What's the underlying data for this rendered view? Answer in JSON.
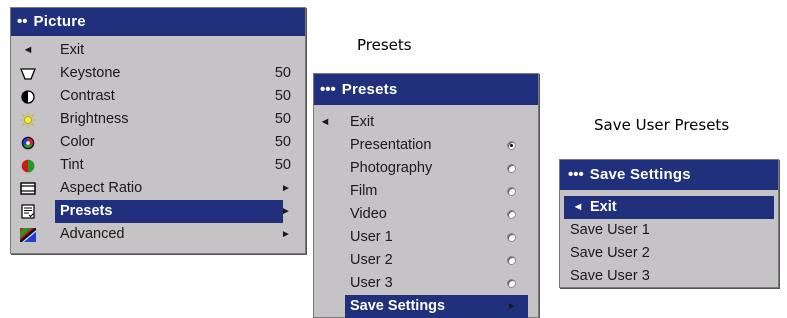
{
  "picture_menu": {
    "title": "Picture",
    "title_dots": "••",
    "items": [
      {
        "icon": "left-arrow-icon",
        "glyph": "◄",
        "label": "Exit",
        "value": ""
      },
      {
        "icon": "keystone-icon",
        "glyph": "",
        "label": "Keystone",
        "value": "50"
      },
      {
        "icon": "contrast-icon",
        "glyph": "",
        "label": "Contrast",
        "value": "50"
      },
      {
        "icon": "brightness-icon",
        "glyph": "",
        "label": "Brightness",
        "value": "50"
      },
      {
        "icon": "color-icon",
        "glyph": "",
        "label": "Color",
        "value": "50"
      },
      {
        "icon": "tint-icon",
        "glyph": "",
        "label": "Tint",
        "value": "50"
      },
      {
        "icon": "aspect-ratio-icon",
        "glyph": "",
        "label": "Aspect Ratio",
        "arrow": "►"
      },
      {
        "icon": "presets-icon",
        "glyph": "",
        "label": "Presets",
        "arrow": "►"
      },
      {
        "icon": "advanced-icon",
        "glyph": "",
        "label": "Advanced",
        "arrow": "►"
      }
    ]
  },
  "presets_menu": {
    "caption": "Presets",
    "title": "Presets",
    "title_dots": "•••",
    "exit_glyph": "◄",
    "items": [
      {
        "label": "Exit"
      },
      {
        "label": "Presentation",
        "radio": "selected"
      },
      {
        "label": "Photography",
        "radio": "unselected"
      },
      {
        "label": "Film",
        "radio": "unselected"
      },
      {
        "label": "Video",
        "radio": "unselected"
      },
      {
        "label": "User 1",
        "radio": "unselected"
      },
      {
        "label": "User 2",
        "radio": "unselected"
      },
      {
        "label": "User 3",
        "radio": "unselected"
      },
      {
        "label": "Save Settings",
        "arrow": "►"
      }
    ]
  },
  "save_menu": {
    "caption": "Save User Presets",
    "title": "Save Settings",
    "title_dots": "•••",
    "exit_glyph": "◄",
    "items": [
      {
        "label": "Exit"
      },
      {
        "label": "Save User 1"
      },
      {
        "label": "Save User 2"
      },
      {
        "label": "Save User 3"
      }
    ]
  },
  "colors": {
    "title_bar": "#21307c",
    "menu_bg": "#c6c3c6",
    "highlight": "#21307c"
  }
}
